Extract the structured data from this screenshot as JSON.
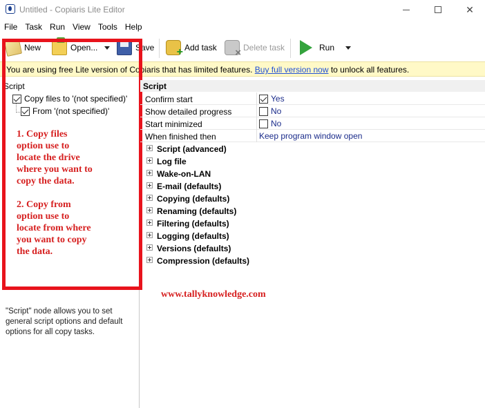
{
  "window": {
    "title": "Untitled - Copiaris Lite Editor"
  },
  "menu": [
    "File",
    "Task",
    "Run",
    "View",
    "Tools",
    "Help"
  ],
  "toolbar": {
    "new_label": "New",
    "open_label": "Open...",
    "save_label": "Save",
    "add_task_label": "Add task",
    "delete_task_label": "Delete task",
    "run_label": "Run"
  },
  "banner": {
    "pre": "You are using free Lite version of Copiaris that has limited features.",
    "link": "Buy full version now",
    "post": "to unlock all features."
  },
  "tree": {
    "root": "Script",
    "task": "Copy files to '(not specified)'",
    "source": "From '(not specified)'"
  },
  "annotation": {
    "note1": [
      "1. Copy files",
      "option use to",
      "locate the drive",
      "where you want to",
      "copy the data."
    ],
    "note2": [
      "2. Copy from",
      "option use to",
      "locate from where",
      "you want to copy",
      "the data."
    ]
  },
  "help_text": "\"Script\" node allows you to set general script options and default options for all copy tasks.",
  "properties": {
    "header": "Script",
    "rows": [
      {
        "name": "Confirm start",
        "value": "Yes",
        "checked": true
      },
      {
        "name": "Show detailed progress",
        "value": "No",
        "checked": false
      },
      {
        "name": "Start minimized",
        "value": "No",
        "checked": false
      },
      {
        "name": "When finished then",
        "value": "Keep program window open"
      }
    ],
    "sections": [
      "Script (advanced)",
      "Log file",
      "Wake-on-LAN",
      "E-mail (defaults)",
      "Copying (defaults)",
      "Renaming (defaults)",
      "Filtering (defaults)",
      "Logging (defaults)",
      "Versions (defaults)",
      "Compression (defaults)"
    ]
  },
  "watermark": "www.tallyknowledge.com",
  "colors": {
    "accent_link": "#1f4fd6",
    "annotation_red": "#d62020",
    "banner_bg": "#fff9c7"
  }
}
